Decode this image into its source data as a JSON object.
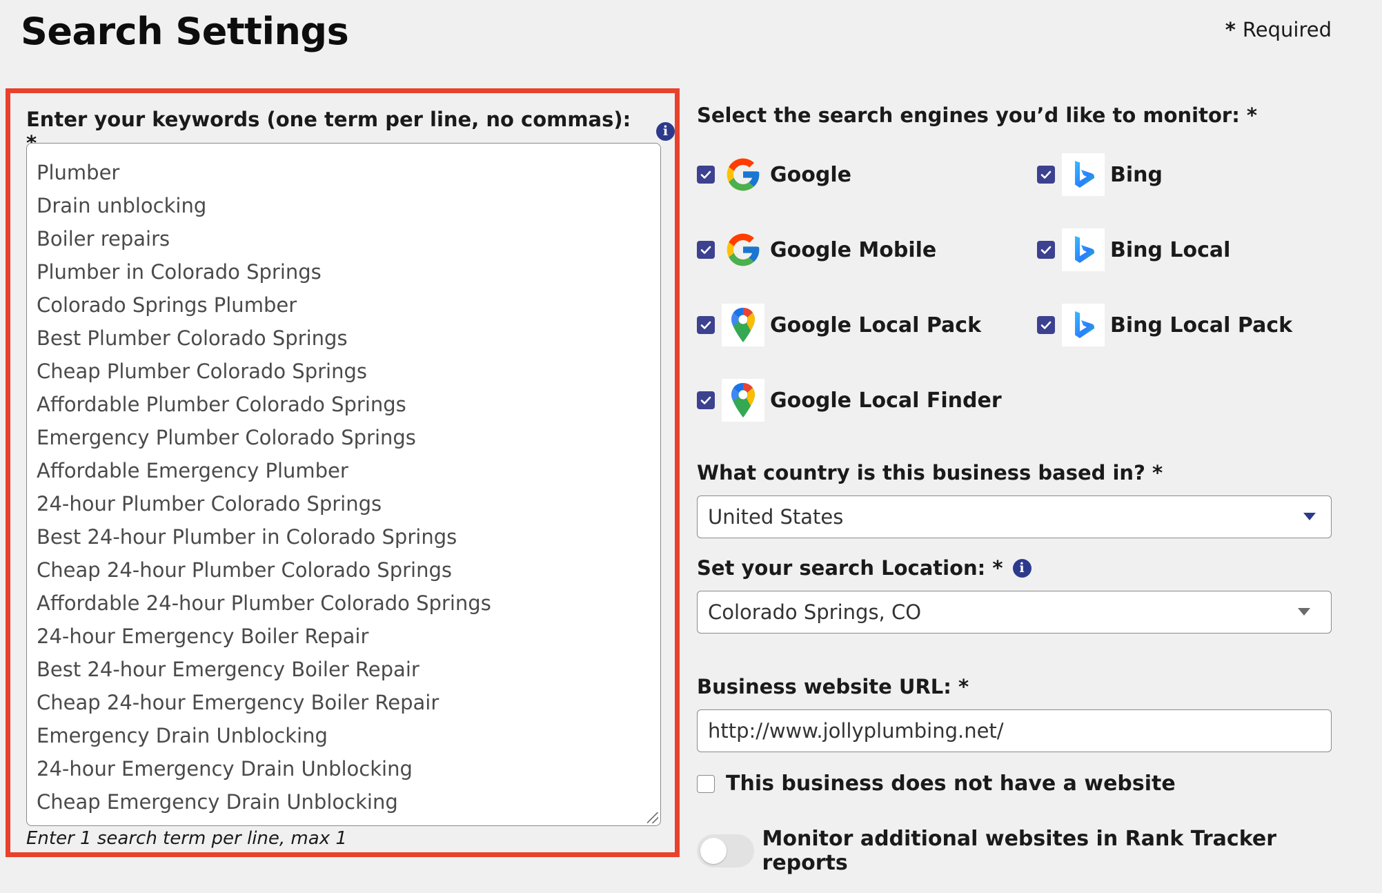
{
  "header": {
    "title": "Search Settings",
    "required_star": "*",
    "required_text": "Required"
  },
  "keywords": {
    "label": "Enter your keywords (one term per line, no commas): *",
    "info_icon": "info-icon",
    "lines": [
      "Plumber",
      "Drain unblocking",
      "Boiler repairs",
      "Plumber in Colorado Springs",
      "Colorado Springs Plumber",
      "Best Plumber Colorado Springs",
      "Cheap Plumber Colorado Springs",
      "Affordable Plumber Colorado Springs",
      "Emergency Plumber Colorado Springs",
      "Affordable Emergency Plumber",
      "24-hour Plumber Colorado Springs",
      "Best 24-hour Plumber in Colorado Springs",
      "Cheap 24-hour Plumber Colorado Springs",
      "Affordable 24-hour Plumber Colorado Springs",
      "24-hour Emergency Boiler Repair",
      "Best 24-hour Emergency Boiler Repair",
      "Cheap 24-hour Emergency Boiler Repair",
      "Emergency Drain Unblocking",
      "24-hour Emergency Drain Unblocking",
      "Cheap Emergency Drain Unblocking"
    ],
    "hint": "Enter 1 search term per line, max 1"
  },
  "engines": {
    "label": "Select the search engines you’d like to monitor: *",
    "items": [
      {
        "name": "Google",
        "checked": true,
        "icon": "google-g-icon"
      },
      {
        "name": "Bing",
        "checked": true,
        "icon": "bing-icon"
      },
      {
        "name": "Google Mobile",
        "checked": true,
        "icon": "google-g-icon"
      },
      {
        "name": "Bing Local",
        "checked": true,
        "icon": "bing-icon"
      },
      {
        "name": "Google Local Pack",
        "checked": true,
        "icon": "google-maps-pin-icon"
      },
      {
        "name": "Bing Local Pack",
        "checked": true,
        "icon": "bing-icon"
      },
      {
        "name": "Google Local Finder",
        "checked": true,
        "icon": "google-maps-pin-icon"
      }
    ]
  },
  "country": {
    "label": "What country is this business based in? *",
    "value": "United States"
  },
  "location": {
    "label": "Set your search Location: *",
    "value": "Colorado Springs, CO"
  },
  "website": {
    "label": "Business website URL: *",
    "value": "http://www.jollyplumbing.net/"
  },
  "no_website": {
    "label": "This business does not have a website",
    "checked": false
  },
  "monitor_additional": {
    "label": "Monitor additional websites in Rank Tracker reports",
    "enabled": false
  },
  "colors": {
    "highlight_border": "#e8412c",
    "checkbox_fill": "#3c4190",
    "info_icon": "#2d3a8c"
  }
}
